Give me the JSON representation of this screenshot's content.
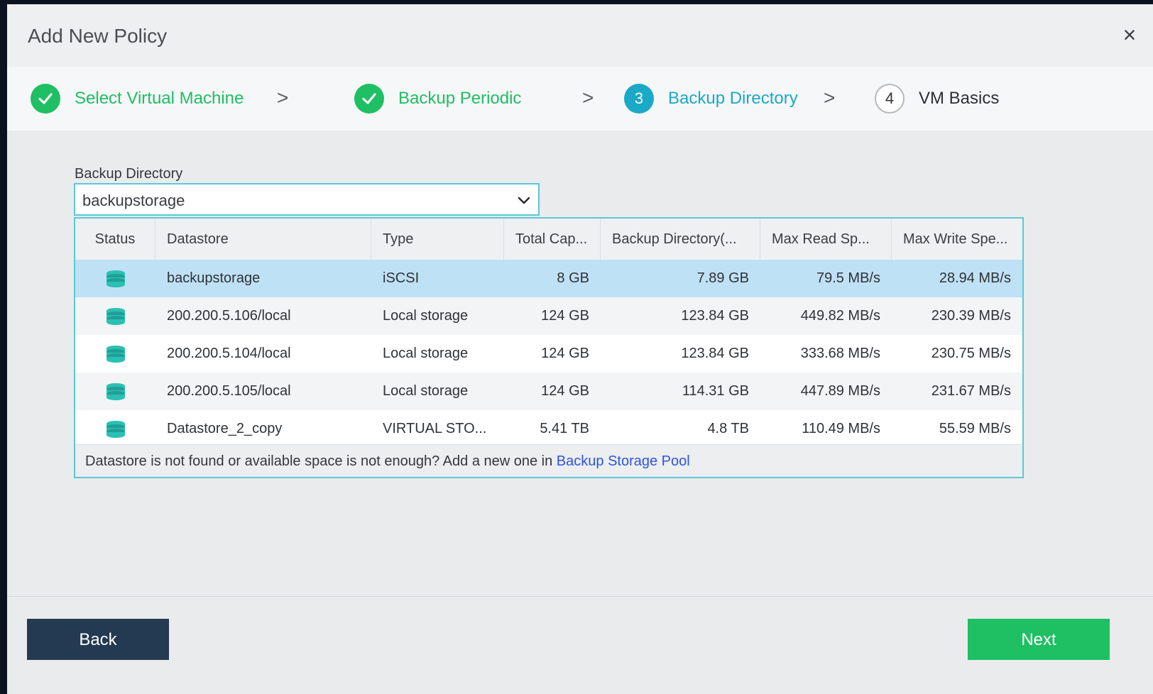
{
  "dialog": {
    "title": "Add New Policy",
    "close_glyph": "×"
  },
  "steps": [
    {
      "state": "done",
      "marker": "",
      "label": "Select Virtual Machine"
    },
    {
      "state": "done",
      "marker": "",
      "label": "Backup Periodic"
    },
    {
      "state": "active",
      "marker": "3",
      "label": "Backup Directory"
    },
    {
      "state": "todo",
      "marker": "4",
      "label": "VM Basics"
    }
  ],
  "step_separator": ">",
  "backup_directory": {
    "label": "Backup Directory",
    "selected": "backupstorage"
  },
  "table": {
    "columns": [
      "Status",
      "Datastore",
      "Type",
      "Total Cap...",
      "Backup Directory(...",
      "Max Read Sp...",
      "Max Write Spe..."
    ],
    "rows": [
      {
        "status_icon": "database-icon",
        "datastore": "backupstorage",
        "type": "iSCSI",
        "total": "8 GB",
        "backup_dir": "7.89 GB",
        "read": "79.5 MB/s",
        "write": "28.94 MB/s",
        "selected": true
      },
      {
        "status_icon": "database-icon",
        "datastore": "200.200.5.106/local",
        "type": "Local storage",
        "total": "124 GB",
        "backup_dir": "123.84 GB",
        "read": "449.82 MB/s",
        "write": "230.39 MB/s",
        "selected": false
      },
      {
        "status_icon": "database-icon",
        "datastore": "200.200.5.104/local",
        "type": "Local storage",
        "total": "124 GB",
        "backup_dir": "123.84 GB",
        "read": "333.68 MB/s",
        "write": "230.75 MB/s",
        "selected": false
      },
      {
        "status_icon": "database-icon",
        "datastore": "200.200.5.105/local",
        "type": "Local storage",
        "total": "124 GB",
        "backup_dir": "114.31 GB",
        "read": "447.89 MB/s",
        "write": "231.67 MB/s",
        "selected": false
      },
      {
        "status_icon": "database-icon",
        "datastore": "Datastore_2_copy",
        "type": "VIRTUAL STO...",
        "total": "5.41 TB",
        "backup_dir": "4.8 TB",
        "read": "110.49 MB/s",
        "write": "55.59 MB/s",
        "selected": false
      }
    ],
    "footer_text": "Datastore is not found or available space is not enough? Add a new one in ",
    "footer_link": "Backup Storage Pool"
  },
  "buttons": {
    "back": "Back",
    "next": "Next"
  },
  "colors": {
    "success": "#1fbf63",
    "active_step": "#1aa9c6",
    "accent_border": "#5bc8d8",
    "selected_row": "#bfe1f6",
    "back_button": "#243a52",
    "link": "#2f54e0",
    "db_icon": "#2bc0b4"
  }
}
